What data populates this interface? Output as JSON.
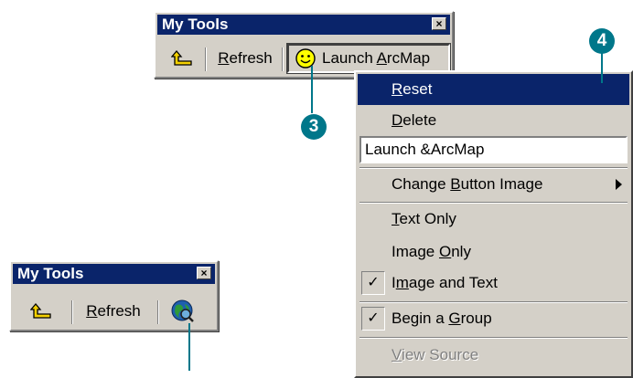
{
  "toolbar_top": {
    "title": "My Tools",
    "close": "×",
    "refresh_label": "Refresh",
    "refresh_underline": "R",
    "refresh_rest": "efresh",
    "launch_pre": "Launch ",
    "launch_underline": "A",
    "launch_rest": "rcMap"
  },
  "toolbar_bottom": {
    "title": "My Tools",
    "close": "×",
    "refresh_underline": "R",
    "refresh_rest": "efresh"
  },
  "menu": {
    "reset_u": "R",
    "reset_rest": "eset",
    "delete_u": "D",
    "delete_rest": "elete",
    "name_value": "Launch &ArcMap",
    "change_pre": "Change ",
    "change_u": "B",
    "change_rest": "utton Image",
    "textonly_u": "T",
    "textonly_rest": "ext Only",
    "imageonly_pre": "Image ",
    "imageonly_u": "O",
    "imageonly_rest": "nly",
    "imagetext_pre": "I",
    "imagetext_u": "m",
    "imagetext_rest": "age and Text",
    "group_pre": "Begin a ",
    "group_u": "G",
    "group_rest": "roup",
    "viewsource_u": "V",
    "viewsource_rest": "iew Source",
    "check_mark": "✓"
  },
  "callouts": {
    "three": "3",
    "four": "4"
  },
  "colors": {
    "callout": "#00778a",
    "titlebar": "#0a246a",
    "face": "#d4d0c8"
  }
}
